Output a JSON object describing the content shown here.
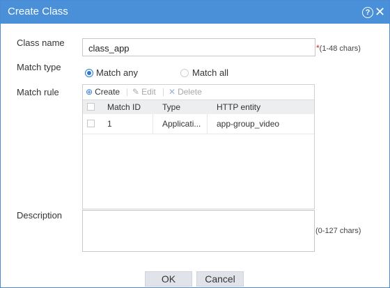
{
  "dialog": {
    "title": "Create Class",
    "help_glyph": "?",
    "close_glyph": "✕"
  },
  "form": {
    "class_name_label": "Class name",
    "class_name_value": "class_app",
    "class_name_required": "*",
    "class_name_hint": "(1-48 chars)",
    "match_type_label": "Match type",
    "match_type_options": [
      {
        "label": "Match any",
        "selected": true
      },
      {
        "label": "Match all",
        "selected": false
      }
    ],
    "match_rule_label": "Match rule",
    "description_label": "Description",
    "description_value": "",
    "description_hint": "(0-127 chars)"
  },
  "rule_toolbar": {
    "create": {
      "glyph": "⊕",
      "label": "Create"
    },
    "edit": {
      "glyph": "✎",
      "label": "Edit"
    },
    "delete": {
      "glyph": "✕",
      "label": "Delete"
    }
  },
  "rule_table": {
    "columns": [
      "Match ID",
      "Type",
      "HTTP entity"
    ],
    "rows": [
      {
        "match_id": "1",
        "type": "Applicati...",
        "http_entity": "app-group_video"
      }
    ]
  },
  "buttons": {
    "ok": "OK",
    "cancel": "Cancel"
  },
  "colors": {
    "title_bar": "#4a90d9",
    "accent": "#2b79d0",
    "required": "#d9241c"
  }
}
